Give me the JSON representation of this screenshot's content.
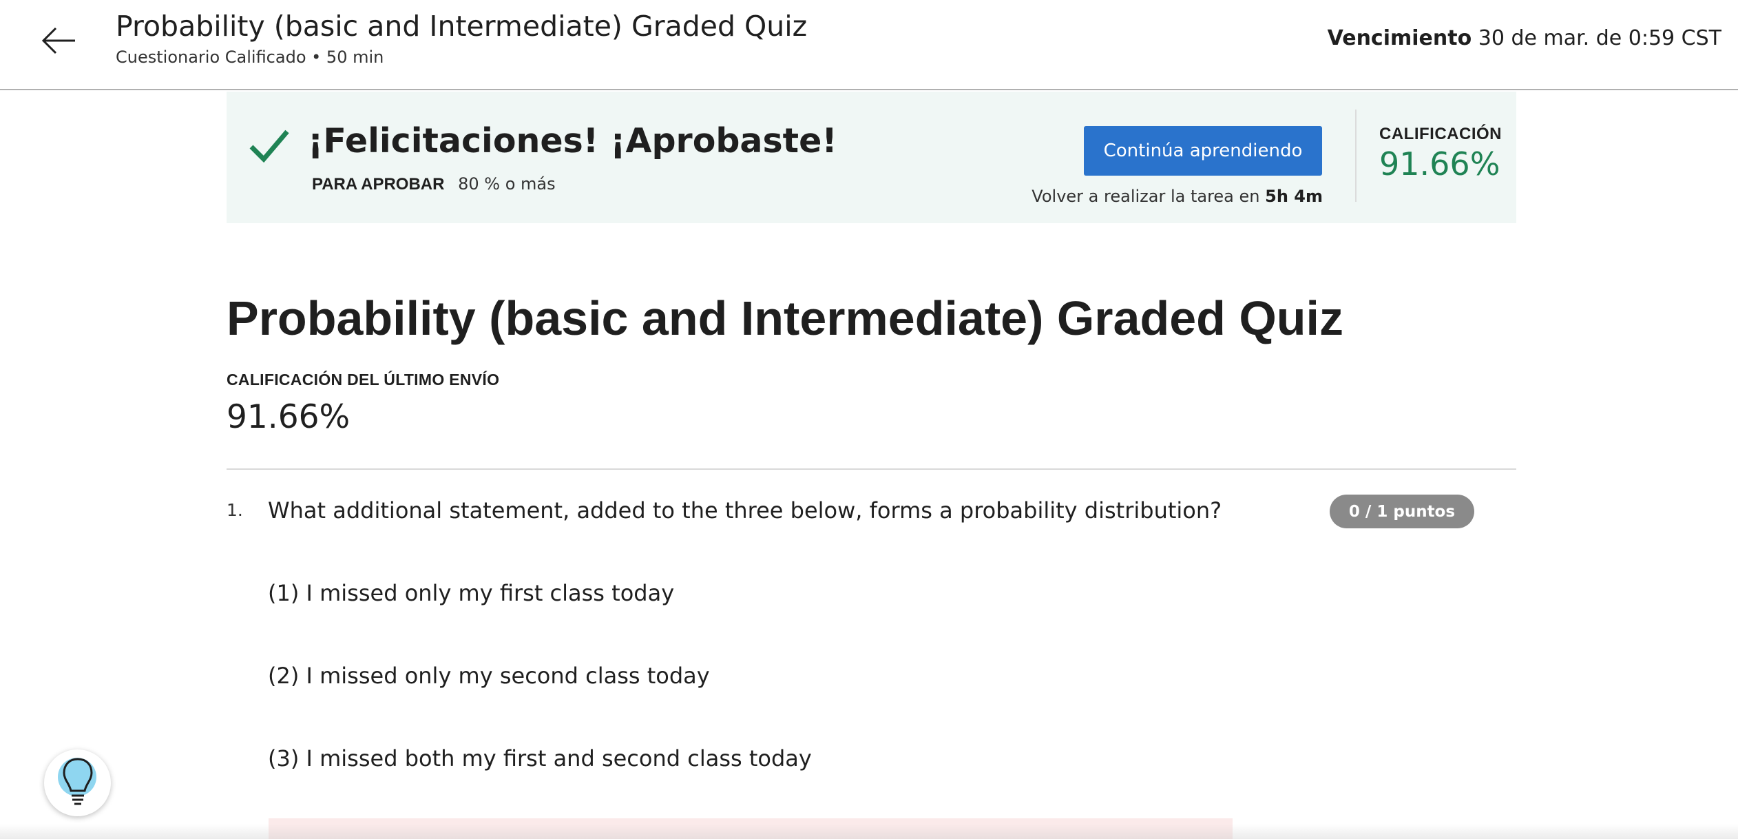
{
  "header": {
    "title": "Probability (basic and Intermediate) Graded Quiz",
    "subtitle": "Cuestionario Calificado • 50 min",
    "due_label": "Vencimiento",
    "due_value": "30 de mar. de 0:59 CST"
  },
  "banner": {
    "message": "¡Felicitaciones! ¡Aprobaste!",
    "to_pass_label": "PARA APROBAR",
    "to_pass_value": "80 % o más",
    "continue_button": "Continúa aprendiendo",
    "retake_text": "Volver a realizar la tarea en",
    "retake_time": "5h 4m",
    "grade_label": "CALIFICACIÓN",
    "grade_value": "91.66%",
    "success_color": "#1f8354",
    "button_color": "#2a73cc"
  },
  "main": {
    "title": "Probability (basic and Intermediate) Graded Quiz",
    "last_submission_label": "CALIFICACIÓN DEL ÚLTIMO ENVÍO",
    "last_submission_value": "91.66%"
  },
  "question": {
    "number": "1.",
    "text": "What additional statement, added to the three below, forms a probability distribution?",
    "points": "0 / 1 puntos",
    "options": [
      "(1) I missed only my first class today",
      "(2) I missed only my second class today",
      "(3) I missed both my first and second class today"
    ]
  },
  "icons": {
    "back": "arrow-left-icon",
    "check": "check-icon",
    "help": "lightbulb-icon"
  }
}
